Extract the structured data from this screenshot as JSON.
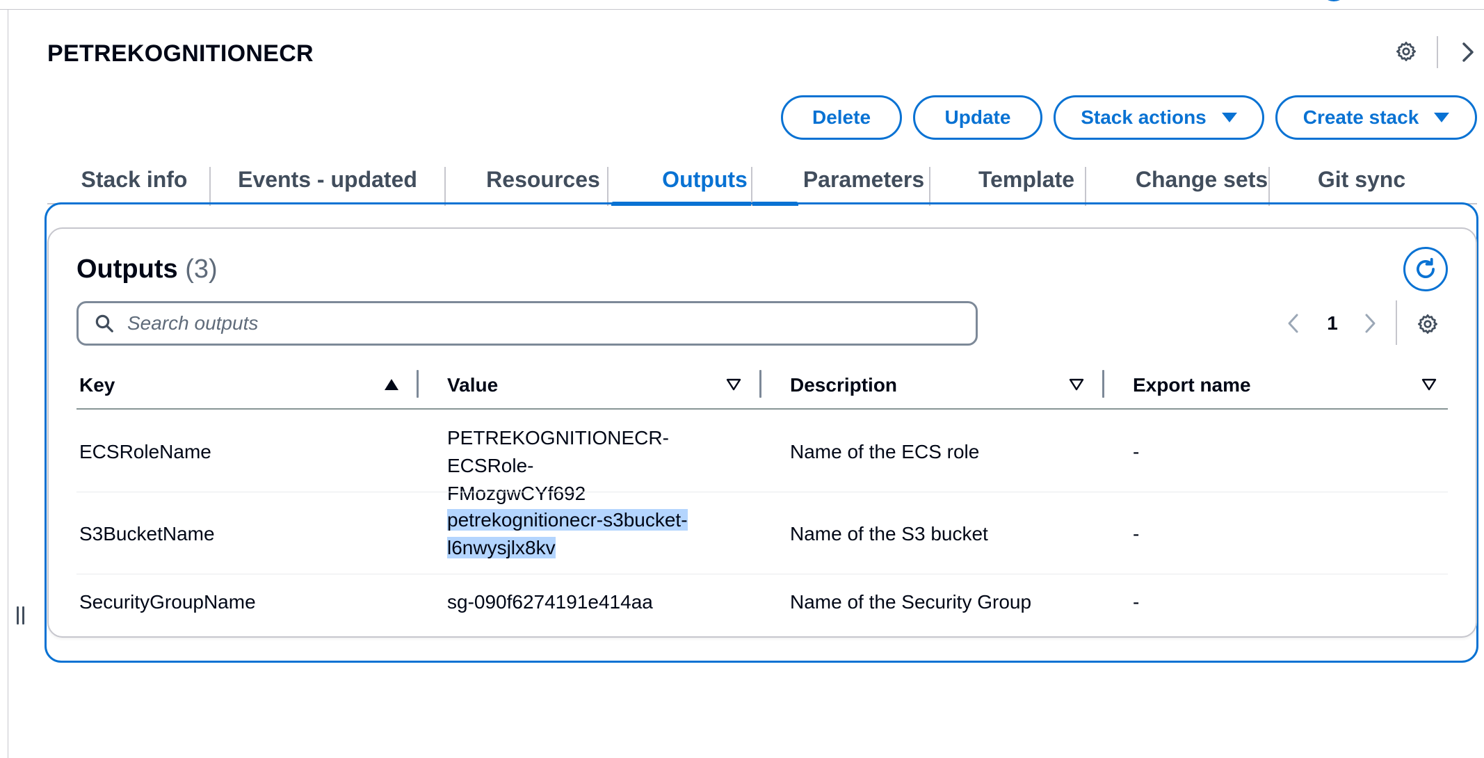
{
  "page": {
    "title": "PETREKOGNITIONECR",
    "settings_icon": "gear-icon",
    "collapse_icon": "chevron-right-icon"
  },
  "actions": {
    "delete": "Delete",
    "update": "Update",
    "stack_actions": "Stack actions",
    "create_stack": "Create stack"
  },
  "tabs": [
    {
      "label": "Stack info"
    },
    {
      "label": "Events - updated"
    },
    {
      "label": "Resources"
    },
    {
      "label": "Outputs",
      "active": true
    },
    {
      "label": "Parameters"
    },
    {
      "label": "Template"
    },
    {
      "label": "Change sets"
    },
    {
      "label": "Git sync"
    }
  ],
  "outputs": {
    "title": "Outputs",
    "count": "(3)",
    "search_placeholder": "Search outputs",
    "current_page": "1",
    "columns": [
      "Key",
      "Value",
      "Description",
      "Export name"
    ],
    "sorted_column": "Key",
    "sort_direction": "ascending",
    "rows": [
      {
        "key": "ECSRoleName",
        "value_line1": "PETREKOGNITIONECR-ECSRole-",
        "value_line2": "FMozgwCYf692",
        "description": "Name of the ECS role",
        "export_name": "-"
      },
      {
        "key": "S3BucketName",
        "value_line1": "petrekognitionecr-s3bucket-",
        "value_line2": "l6nwysjlx8kv",
        "description": "Name of the S3 bucket",
        "export_name": "-"
      },
      {
        "key": "SecurityGroupName",
        "value": "sg-090f6274191e414aa",
        "description": "Name of the Security Group",
        "export_name": "-"
      }
    ]
  },
  "colors": {
    "accent": "#0972d3",
    "text": "#000716",
    "muted": "#5f6b7a",
    "selection": "#b4d5fe",
    "border": "#c6c6cd"
  }
}
